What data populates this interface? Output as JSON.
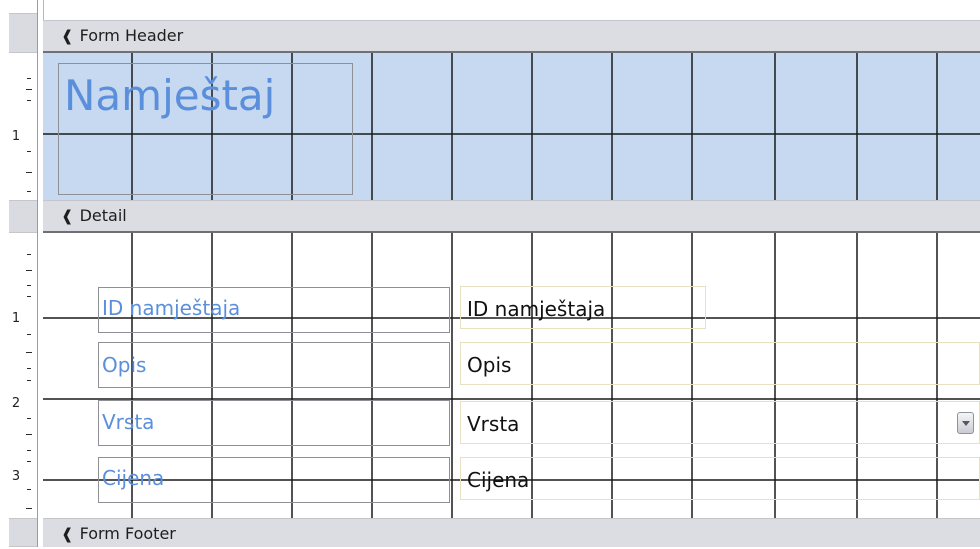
{
  "sections": {
    "form_header": "Form Header",
    "detail": "Detail",
    "form_footer": "Form Footer"
  },
  "header": {
    "title_label": "Namještaj"
  },
  "ruler": {
    "header_numbers": [
      "1"
    ],
    "detail_numbers": [
      "1",
      "2",
      "3"
    ]
  },
  "fields": [
    {
      "label": "ID namještaja",
      "control": "ID namještaja",
      "type": "textbox"
    },
    {
      "label": "Opis",
      "control": "Opis",
      "type": "textbox"
    },
    {
      "label": "Vrsta",
      "control": "Vrsta",
      "type": "combobox"
    },
    {
      "label": "Cijena",
      "control": "Cijena",
      "type": "textbox"
    }
  ],
  "icons": {
    "section_toggle": "section-collapse-arrow-icon",
    "combo_dropdown": "chevron-down-icon"
  },
  "colors": {
    "header_background": "#c6d9f1",
    "label_text": "#5b8fdc",
    "section_bar": "#dcdde2",
    "grid_line": "#1a1a1a"
  }
}
